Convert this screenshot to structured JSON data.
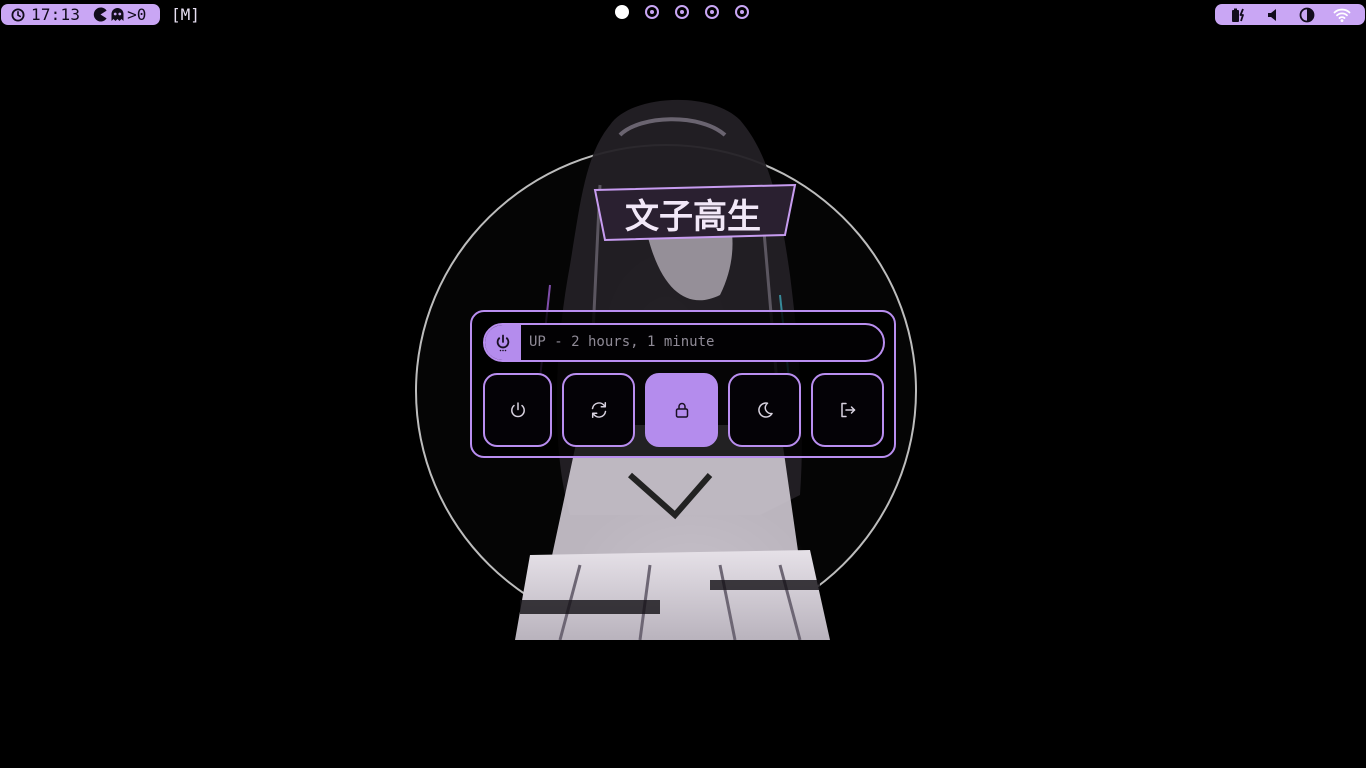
{
  "topbar": {
    "left": {
      "clock_icon": "clock-icon",
      "time": "17:13",
      "pacman_icon": "pacman-icon",
      "ghost_icon": "ghost-icon",
      "counter": ">0"
    },
    "mode": "[M]",
    "workspaces": [
      {
        "id": 1,
        "active": true
      },
      {
        "id": 2,
        "active": false
      },
      {
        "id": 3,
        "active": false
      },
      {
        "id": 4,
        "active": false
      },
      {
        "id": 5,
        "active": false
      }
    ],
    "right": {
      "icons": [
        "battery-charging-icon",
        "volume-icon",
        "brightness-icon",
        "wifi-icon"
      ]
    }
  },
  "power_menu": {
    "uptime_icon": "power-icon",
    "uptime_text": "UP - 2 hours, 1 minute",
    "buttons": [
      {
        "name": "shutdown",
        "icon": "power-icon",
        "selected": false
      },
      {
        "name": "reboot",
        "icon": "refresh-icon",
        "selected": false
      },
      {
        "name": "lock",
        "icon": "lock-icon",
        "selected": true
      },
      {
        "name": "suspend",
        "icon": "moon-icon",
        "selected": false
      },
      {
        "name": "logout",
        "icon": "logout-icon",
        "selected": false
      }
    ]
  },
  "wallpaper": {
    "headband_text": "文子高生"
  },
  "colors": {
    "accent": "#c9a6f4",
    "accent_dark": "#b48ced",
    "background": "#000000",
    "ring": "#bdbdbd"
  }
}
